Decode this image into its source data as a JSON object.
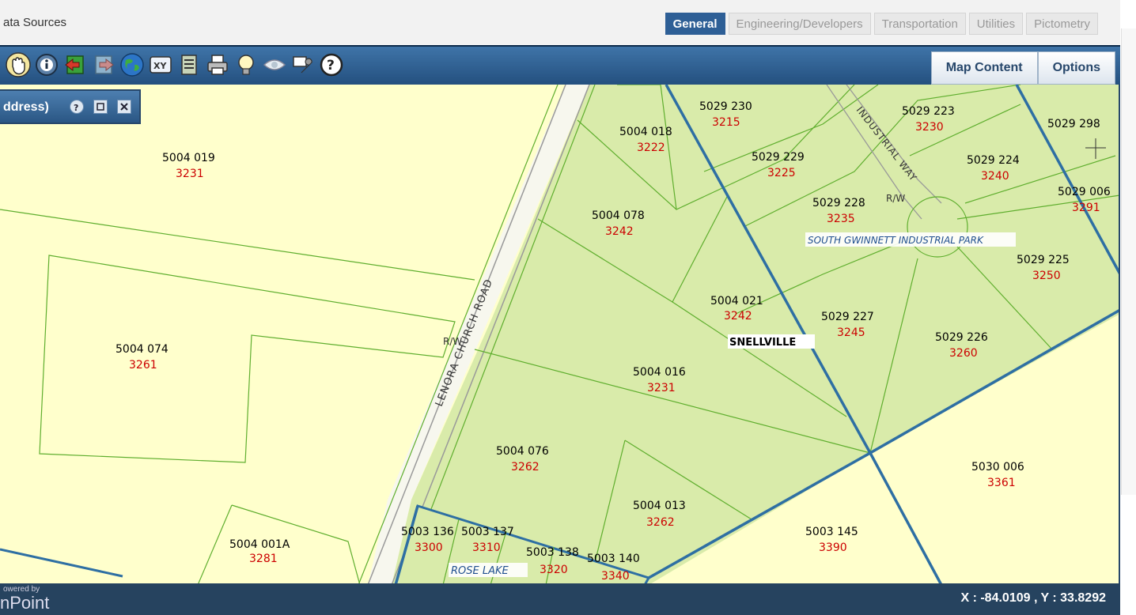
{
  "header": {
    "data_sources_label": "ata Sources",
    "tabs": [
      {
        "label": "General",
        "active": true
      },
      {
        "label": "Engineering/Developers",
        "active": false
      },
      {
        "label": "Transportation",
        "active": false
      },
      {
        "label": "Utilities",
        "active": false
      },
      {
        "label": "Pictometry",
        "active": false
      }
    ]
  },
  "toolbar": {
    "tools": [
      "pan-hand-icon",
      "identify-icon",
      "previous-extent-icon",
      "next-extent-icon",
      "full-extent-globe-icon",
      "xy-coordinate-icon",
      "report-list-icon",
      "print-icon",
      "lightbulb-icon",
      "eye-icon",
      "tools-icon",
      "help-icon"
    ],
    "map_content_label": "Map Content",
    "options_label": "Options"
  },
  "search_panel": {
    "title": "ddress)"
  },
  "map": {
    "parcels": [
      {
        "id": "5004 019",
        "addr": "3231"
      },
      {
        "id": "5004 074",
        "addr": "3261"
      },
      {
        "id": "5004 001A",
        "addr": "3281"
      },
      {
        "id": "5004 018",
        "addr": "3222"
      },
      {
        "id": "5004 078",
        "addr": "3242"
      },
      {
        "id": "5004 021",
        "addr": "3242"
      },
      {
        "id": "5004 016",
        "addr": "3231"
      },
      {
        "id": "5004 076",
        "addr": "3262"
      },
      {
        "id": "5004 013",
        "addr": "3262"
      },
      {
        "id": "5029 230",
        "addr": "3215"
      },
      {
        "id": "5029 229",
        "addr": "3225"
      },
      {
        "id": "5029 228",
        "addr": "3235"
      },
      {
        "id": "5029 227",
        "addr": "3245"
      },
      {
        "id": "5029 226",
        "addr": "3260"
      },
      {
        "id": "5029 225",
        "addr": "3250"
      },
      {
        "id": "5029 224",
        "addr": "3240"
      },
      {
        "id": "5029 223",
        "addr": "3230"
      },
      {
        "id": "5029 298",
        "addr": ""
      },
      {
        "id": "5029 006",
        "addr": "3291"
      },
      {
        "id": "5030 006",
        "addr": "3361"
      },
      {
        "id": "5003 145",
        "addr": "3390"
      },
      {
        "id": "5003 136",
        "addr": "3300"
      },
      {
        "id": "5003 137",
        "addr": "3310"
      },
      {
        "id": "5003 138",
        "addr": "3320"
      },
      {
        "id": "5003 140",
        "addr": "3340"
      }
    ],
    "road_label": "LENORA CHURCH ROAD",
    "row_labels": [
      "R/W",
      "R/W"
    ],
    "industrial_way_label": "INDUSTRIAL WAY",
    "subdivision_label": "SOUTH GWINNETT INDUSTRIAL PARK",
    "city_label": "SNELLVILLE",
    "rose_lake_label": "ROSE LAKE",
    "colors": {
      "parcel_fill": "#d9ebaa",
      "outside_fill": "#ffffcc",
      "parcel_line": "#5fae2e",
      "boundary_line": "#2e6fa3",
      "road_line": "#999999",
      "address_text": "#cc0000"
    }
  },
  "status": {
    "powered_by": "owered by",
    "brand": "nPoint",
    "coordinates": "X : -84.0109 , Y : 33.8292"
  }
}
